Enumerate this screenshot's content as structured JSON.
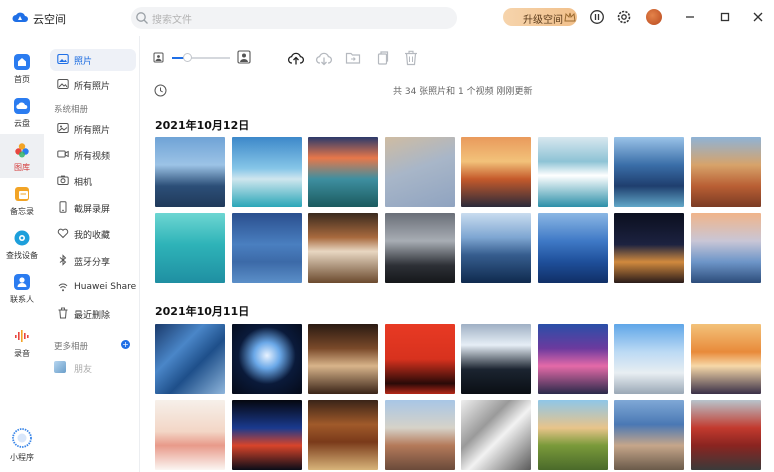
{
  "app": {
    "title": "云空间"
  },
  "search": {
    "placeholder": "搜索文件"
  },
  "header": {
    "upgrade_label": "升级空间"
  },
  "nav": [
    {
      "label": "首页",
      "icon": "home-icon",
      "color": "#2b7cf0"
    },
    {
      "label": "云盘",
      "icon": "cloud-drive-icon",
      "color": "#2b7cf0"
    },
    {
      "label": "图库",
      "icon": "gallery-icon",
      "color": "#e8463e"
    },
    {
      "label": "备忘录",
      "icon": "notes-icon",
      "color": "#f2a426"
    },
    {
      "label": "查找设备",
      "icon": "find-device-icon",
      "color": "#1d9fdb"
    },
    {
      "label": "联系人",
      "icon": "contacts-icon",
      "color": "#2b7cf0"
    },
    {
      "label": "录音",
      "icon": "recorder-icon",
      "color": "#e8463e"
    },
    {
      "label": "小程序",
      "icon": "mini-program-icon",
      "color": "#3a86e8"
    }
  ],
  "sidebar": {
    "top_items": [
      {
        "label": "照片",
        "icon": "photo-icon"
      },
      {
        "label": "所有照片",
        "icon": "all-photos-icon"
      }
    ],
    "system_albums_heading": "系统相册",
    "system_albums": [
      {
        "label": "所有照片",
        "icon": "image-icon"
      },
      {
        "label": "所有视频",
        "icon": "video-icon"
      },
      {
        "label": "相机",
        "icon": "camera-icon"
      },
      {
        "label": "截屏录屏",
        "icon": "screenshot-icon"
      },
      {
        "label": "我的收藏",
        "icon": "heart-icon"
      },
      {
        "label": "蓝牙分享",
        "icon": "bluetooth-icon"
      },
      {
        "label": "Huawei Share",
        "icon": "huawei-share-icon"
      },
      {
        "label": "最近删除",
        "icon": "trash-icon"
      }
    ],
    "more_albums_heading": "更多相册",
    "more_albums": [
      {
        "label": "朋友"
      }
    ]
  },
  "toolbar": {
    "tools": [
      "upload-icon",
      "download-icon",
      "move-to-album-icon",
      "copy-icon",
      "delete-icon"
    ],
    "zoom": 0.25
  },
  "status": {
    "count_text": "共 34 张照片和 1 个视频   刚刚更新"
  },
  "sections": [
    {
      "date": "2021年10月12日",
      "photos": [
        "linear-gradient(180deg,#6fa3d6 0%,#9cc3e6 40%,#2c4f78 70%,#203a5a 100%)",
        "linear-gradient(180deg,#3d88c9 0%,#86c6e8 45%,#cfe6ee 60%,#2aa6b8 100%)",
        "linear-gradient(180deg,#2b3a6b 0%,#e7774a 30%,#3e8fa0 60%,#1b5a5e 100%)",
        "linear-gradient(160deg,#cfbca2 0%,#a8b6c8 45%,#8fa3c0 100%)",
        "linear-gradient(180deg,#e99a5c 0%,#f2c27a 35%,#c55a2b 60%,#2b2a3a 100%)",
        "linear-gradient(180deg,#d7e7ef 0%,#8ec3d5 35%,#ffffff 55%,#2c8fa8 100%)",
        "linear-gradient(180deg,#9ac3e8 0%,#3a6ea8 40%,#1f3e6e 70%,#62a7c8 100%)",
        "linear-gradient(180deg,#8fb3d6 0%,#d7a36a 40%,#b95f34 70%,#7a3b24 100%)"
      ]
    },
    {
      "date": "",
      "photos": [
        "linear-gradient(180deg,#6dd6d2 0%,#2eb3b8 45%,#1f8fa2 100%)",
        "linear-gradient(180deg,#2a4f8e 0%,#4a7fc0 45%,#3c6aa8 70%,#5b8fc8 100%)",
        "linear-gradient(180deg,#3a2a1e 0%,#a86a3e 35%,#e8d7c2 55%,#6b4a2e 100%)",
        "linear-gradient(180deg,#6a6f78 0%,#a8adb4 40%,#2d3036 75%,#15171a 100%)",
        "linear-gradient(180deg,#c9dcef 0%,#7ea6d2 35%,#365d8e 60%,#0f2a4e 100%)",
        "linear-gradient(180deg,#8bb7e4 0%,#3f79c6 40%,#1e4f9a 70%,#102f66 100%)",
        "linear-gradient(180deg,#0b0f1f 0%,#1c2240 45%,#d18a3e 70%,#2a1c1a 100%)",
        "linear-gradient(180deg,#f0b48a 0%,#c9c6d6 40%,#6d95c8 70%,#2c4c7a 100%)"
      ]
    },
    {
      "date": "2021年10月11日",
      "photos": [
        "linear-gradient(135deg,#1a3a6b 0%,#4a86c8 35%,#1e4f8a 60%,#8fb6dc 100%)",
        "radial-gradient(circle at 50% 45%,#e8f2ff 0%,#6aa8e8 25%,#0a1a3a 55%,#050a18 100%)",
        "linear-gradient(180deg,#2a1a12 0%,#7a4a2a 35%,#d8b48a 60%,#3a2418 100%)",
        "linear-gradient(180deg,#e83a24 0%,#d8321e 50%,#2a0a08 85%,#b52818 100%)",
        "linear-gradient(180deg,#9fb0c4 0%,#e6eef6 30%,#1b2430 65%,#0a0e14 100%)",
        "linear-gradient(180deg,#2a4fa8 0%,#6c3a9e 35%,#e46aa8 60%,#2a2a4a 100%)",
        "linear-gradient(180deg,#5fa6e8 0%,#bcdaf4 40%,#e8eef2 70%,#9aa8b6 100%)",
        "linear-gradient(180deg,#f3c27a 0%,#e88a3a 40%,#f6d8a8 60%,#3a3048 100%)"
      ]
    },
    {
      "date": "",
      "photos": [
        "linear-gradient(180deg,#f6f0ea 0%,#f3d6c6 45%,#e89a8a 65%,#fbf6f2 100%)",
        "linear-gradient(180deg,#05070f 0%,#1a3a8e 40%,#d8442a 65%,#0a0c18 100%)",
        "linear-gradient(180deg,#3a2418 0%,#a05a2a 35%,#7a3a1a 60%,#d8b47a 100%)",
        "linear-gradient(180deg,#a8c6e6 0%,#d6d2c8 40%,#b47a5a 65%,#6a4a3a 100%)",
        "linear-gradient(135deg,#eeeeee 0%,#9a9a9a 35%,#f2f2f2 55%,#5a5a5a 100%)",
        "linear-gradient(180deg,#8fc6e8 0%,#e8c48a 40%,#7a9a3a 65%,#4a6a2a 100%)",
        "linear-gradient(180deg,#7fa8d6 0%,#4a78b4 35%,#c6a68a 65%,#6a5a4a 100%)",
        "linear-gradient(180deg,#b8c4cc 0%,#c23a2e 40%,#8a2420 65%,#3a3a3a 100%)"
      ]
    }
  ]
}
